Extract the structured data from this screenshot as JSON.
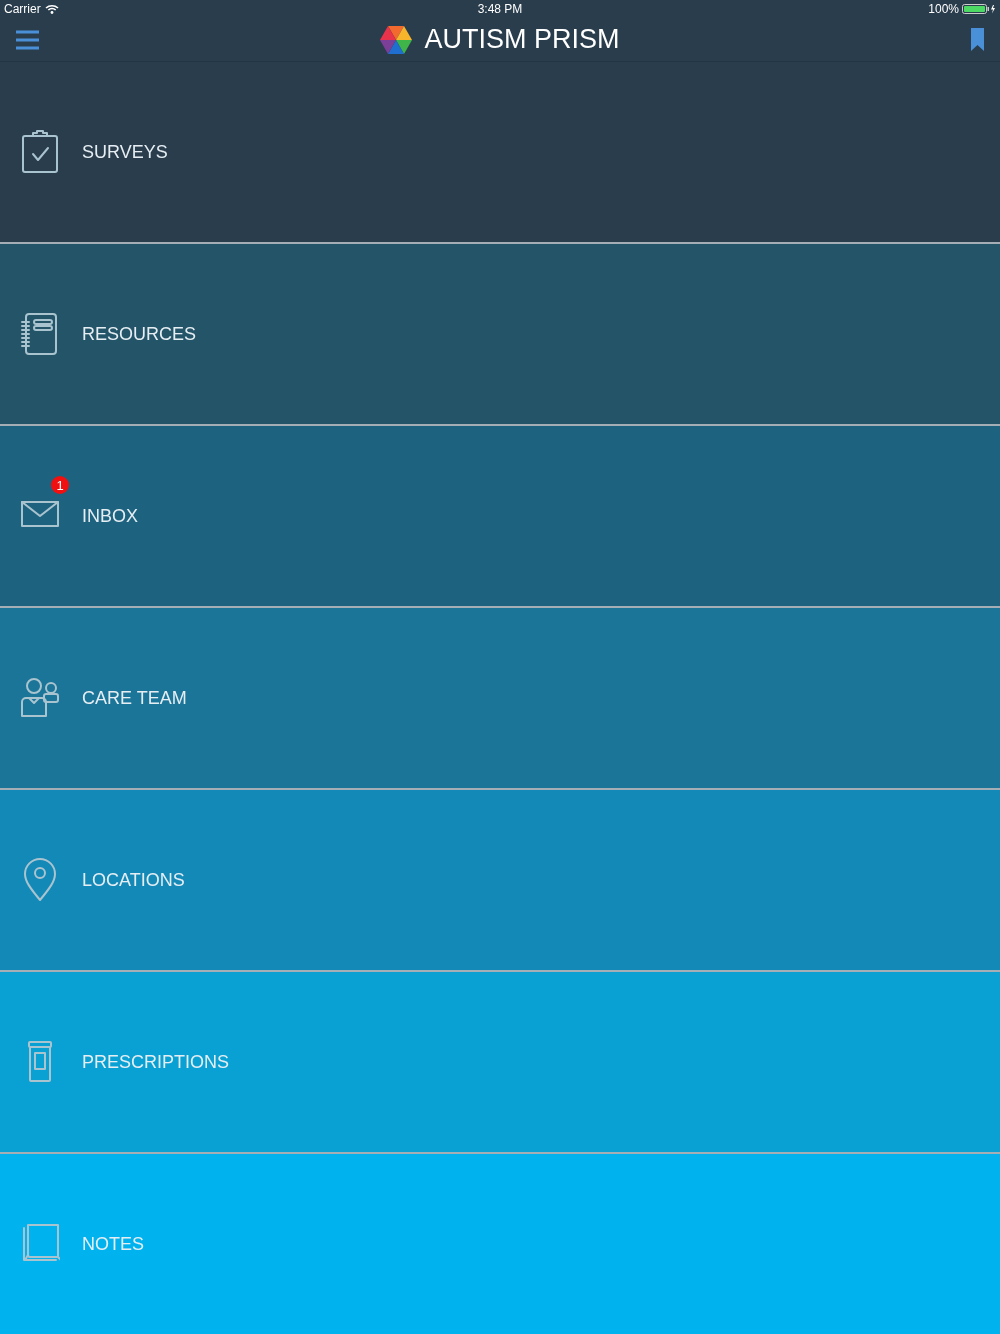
{
  "status_bar": {
    "carrier": "Carrier",
    "time": "3:48 PM",
    "battery": "100%"
  },
  "header": {
    "title": "AUTISM PRISM"
  },
  "menu": [
    {
      "kind": "surveys",
      "label": "SURVEYS",
      "color": "#2a3d4d"
    },
    {
      "kind": "resources",
      "label": "RESOURCES",
      "color": "#235468"
    },
    {
      "kind": "inbox",
      "label": "INBOX",
      "color": "#1d6380",
      "badge": "1"
    },
    {
      "kind": "team",
      "label": "CARE TEAM",
      "color": "#1a7599"
    },
    {
      "kind": "locations",
      "label": "LOCATIONS",
      "color": "#1389b8"
    },
    {
      "kind": "prescriptions",
      "label": "PRESCRIPTIONS",
      "color": "#09a0d3"
    },
    {
      "kind": "notes",
      "label": "NOTES",
      "color": "#00b2ed"
    }
  ]
}
